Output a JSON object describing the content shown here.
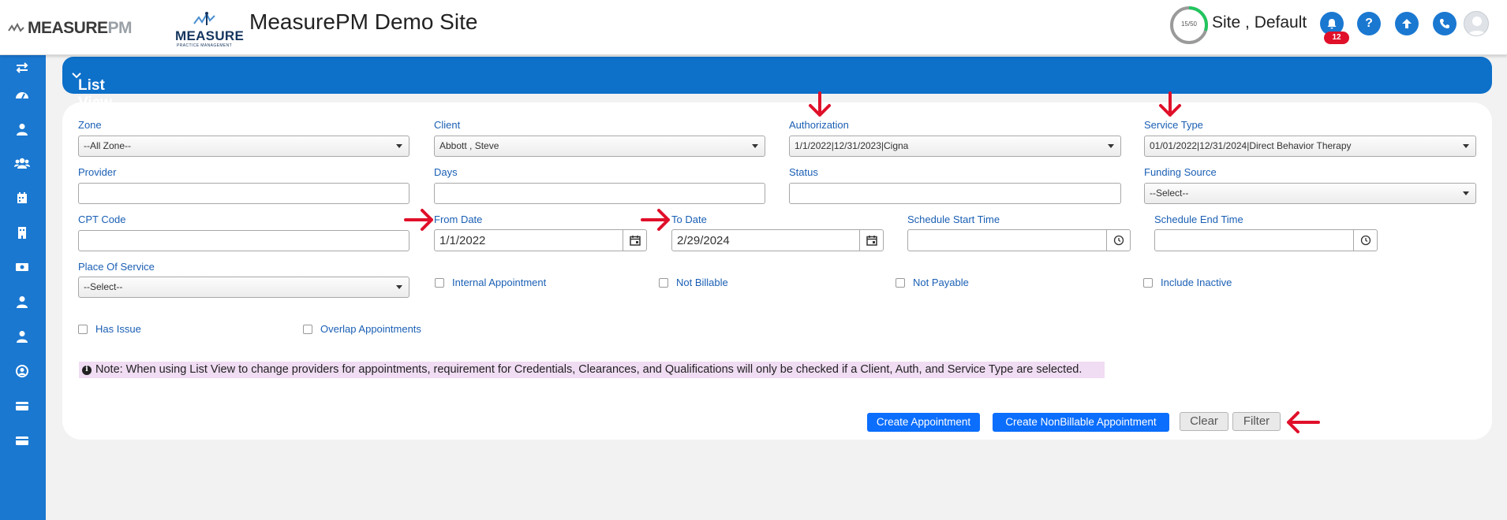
{
  "header": {
    "logo_left_part1": "MEASURE",
    "logo_left_part2": "PM",
    "logo_center_text": "MEASURE",
    "logo_center_sub": "PRACTICE MANAGEMENT",
    "site_title": "MeasurePM Demo Site",
    "progress_label": "15/50",
    "progress_fraction": 0.3,
    "user_name": "Site , Default",
    "notification_count": "12"
  },
  "page": {
    "title": "List View"
  },
  "filters": {
    "zone_label": "Zone",
    "zone_value": "--All Zone--",
    "client_label": "Client",
    "client_value": "Abbott , Steve",
    "authorization_label": "Authorization",
    "authorization_value": "1/1/2022|12/31/2023|Cigna",
    "service_type_label": "Service Type",
    "service_type_value": "01/01/2022|12/31/2024|Direct Behavior Therapy",
    "provider_label": "Provider",
    "provider_value": "",
    "days_label": "Days",
    "days_value": "",
    "status_label": "Status",
    "status_value": "",
    "funding_source_label": "Funding Source",
    "funding_source_value": "--Select--",
    "cpt_code_label": "CPT Code",
    "cpt_code_value": "",
    "from_date_label": "From Date",
    "from_date_value": "1/1/2022",
    "to_date_label": "To Date",
    "to_date_value": "2/29/2024",
    "schedule_start_label": "Schedule Start Time",
    "schedule_start_value": "",
    "schedule_end_label": "Schedule End Time",
    "schedule_end_value": "",
    "place_of_service_label": "Place Of Service",
    "place_of_service_value": "--Select--"
  },
  "checkboxes": {
    "internal_appointment": "Internal Appointment",
    "not_billable": "Not Billable",
    "not_payable": "Not Payable",
    "include_inactive": "Include Inactive",
    "has_issue": "Has Issue",
    "overlap_appointments": "Overlap Appointments"
  },
  "note": "Note: When using List View to change providers for appointments, requirement for Credentials, Clearances, and Qualifications will only be checked if a Client, Auth, and Service Type are selected.",
  "buttons": {
    "create_appointment": "Create Appointment",
    "create_nonbillable": "Create NonBillable Appointment",
    "clear": "Clear",
    "filter": "Filter"
  },
  "colors": {
    "primary_blue": "#1a78d1",
    "title_bar_blue": "#0d70c9",
    "button_blue": "#0b6efd",
    "annotation_red": "#e0102a",
    "note_bg": "#f0dcf3",
    "progress_green": "#22c55e"
  },
  "sidebar_icons": [
    "exchange-icon",
    "dashboard-icon",
    "user-icon",
    "users-icon",
    "calendar-icon",
    "building-icon",
    "money-icon",
    "user-icon",
    "user-icon",
    "user-circle-icon",
    "credit-card-icon",
    "credit-card-icon"
  ]
}
